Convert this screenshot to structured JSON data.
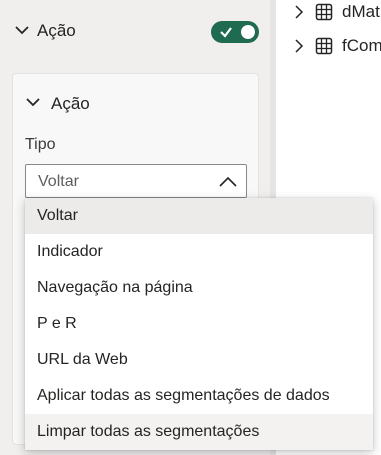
{
  "format_pane": {
    "section_title": "Ação",
    "toggle_on": true,
    "card": {
      "title": "Ação",
      "type_label": "Tipo",
      "selected_value": "Voltar"
    }
  },
  "dropdown": {
    "options": [
      "Voltar",
      "Indicador",
      "Navegação na página",
      "P e R",
      "URL da Web",
      "Aplicar todas as segmentações de dados",
      "Limpar todas as segmentações"
    ],
    "selected_index": 0,
    "hovered_index": 6
  },
  "fields_pane": {
    "tables": [
      "dMat",
      "fCom"
    ]
  },
  "colors": {
    "toggle_on": "#1e6b52",
    "selected_option_bg": "#ecebea"
  }
}
